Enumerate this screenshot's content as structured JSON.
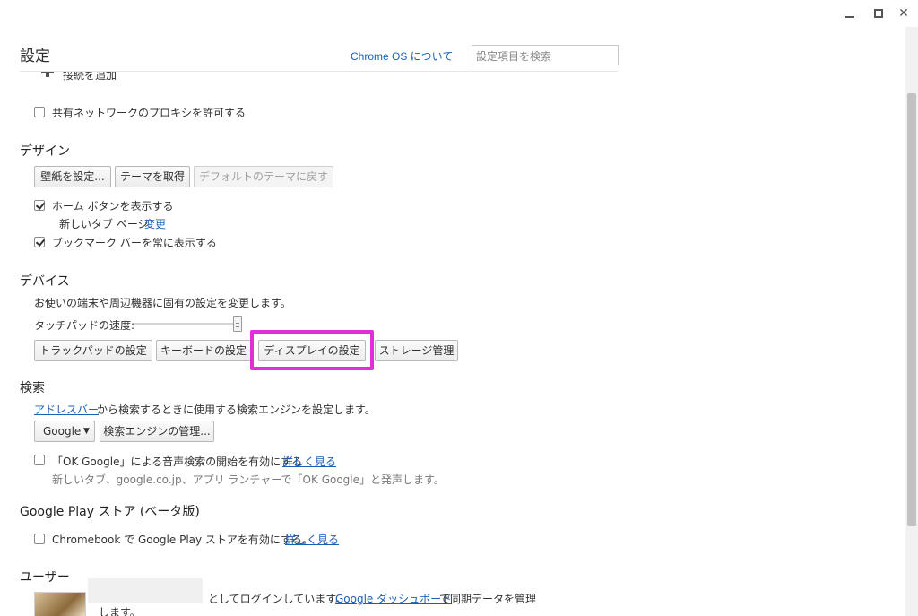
{
  "window": {
    "minimize_icon": "minimize-icon",
    "maximize_icon": "maximize-icon",
    "close_icon": "close-icon",
    "close_glyph": "✕"
  },
  "header": {
    "title": "設定",
    "about_link": "Chrome OS について",
    "search_placeholder": "設定項目を検索"
  },
  "network": {
    "add_connection": "接続を追加",
    "allow_proxy": "共有ネットワークのプロキシを許可する",
    "allow_proxy_checked": false
  },
  "design": {
    "title": "デザイン",
    "wallpaper_button": "壁紙を設定...",
    "get_theme_button": "テーマを取得",
    "reset_theme_button": "デフォルトのテーマに戻す",
    "show_home_button": "ホーム ボタンを表示する",
    "show_home_checked": true,
    "new_tab_text": "新しいタブ ページ",
    "change_link": "変更",
    "show_bookmarks": "ブックマーク バーを常に表示する",
    "show_bookmarks_checked": true
  },
  "device": {
    "title": "デバイス",
    "description": "お使いの端末や周辺機器に固有の設定を変更します。",
    "touchpad_speed_label": "タッチパッドの速度:",
    "touchpad_speed_fraction": 1.0,
    "trackpad_button": "トラックパッドの設定",
    "keyboard_button": "キーボードの設定",
    "display_button": "ディスプレイの設定",
    "storage_button": "ストレージ管理"
  },
  "search": {
    "title": "検索",
    "addressbar_link": "アドレスバー",
    "description": "から検索するときに使用する検索エンジンを設定します。",
    "engine_selected": "Google",
    "manage_button": "検索エンジンの管理...",
    "ok_google_label": "「OK Google」による音声検索の開始を有効にする",
    "ok_google_checked": false,
    "learn_more": "詳しく見る",
    "ok_google_hint": "新しいタブ、google.co.jp、アプリ ランチャーで「OK Google」と発声します。"
  },
  "play_store": {
    "title": "Google Play ストア (ベータ版)",
    "enable_label": "Chromebook で Google Play ストアを有効にする。",
    "enable_checked": false,
    "learn_more": "詳しく見る"
  },
  "users": {
    "title": "ユーザー",
    "logged_in_text": "としてログインしています。",
    "dashboard_link": "Google ダッシュボード",
    "sync_text": "で同期データを管理",
    "sync_text_2": "します。"
  },
  "colors": {
    "highlight": "#e02fd6",
    "link": "#1a5fb4"
  }
}
